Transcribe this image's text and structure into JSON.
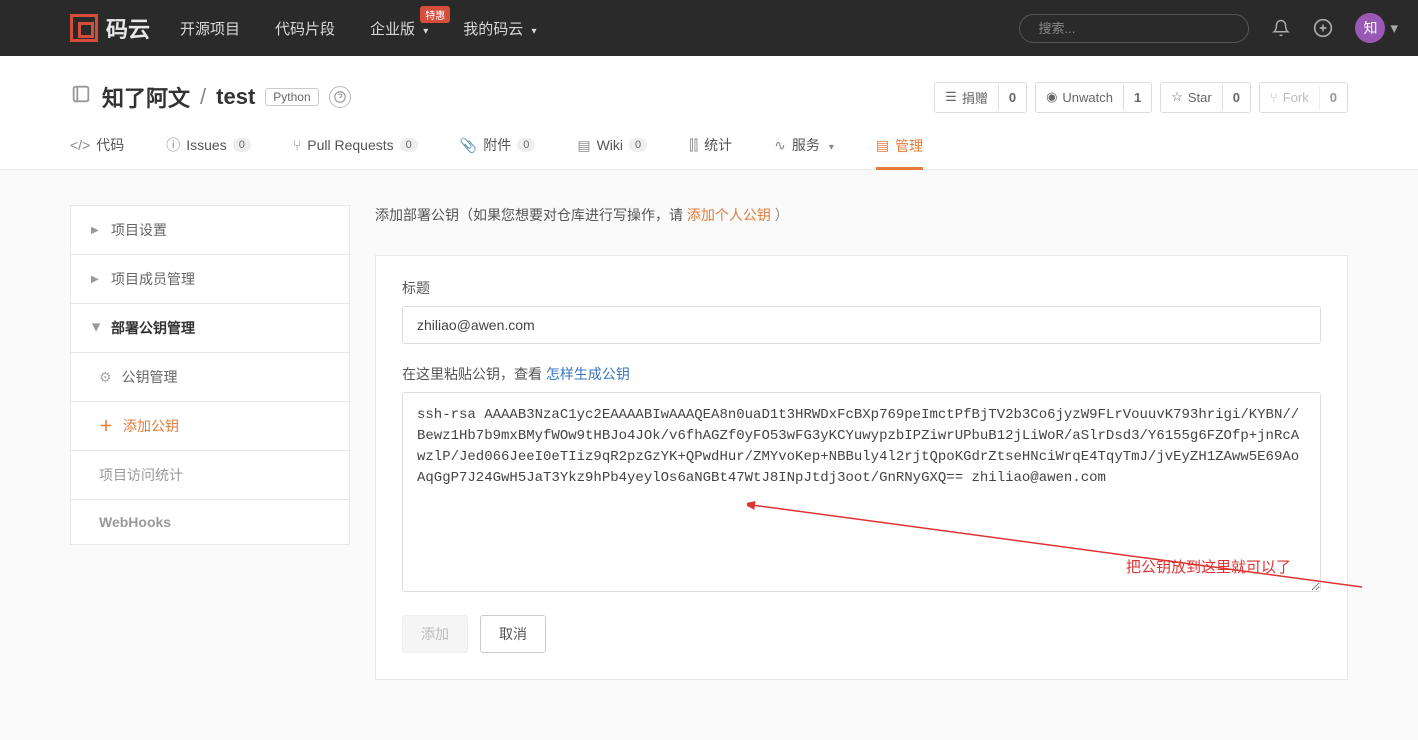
{
  "topnav": {
    "brand": "码云",
    "items": [
      "开源项目",
      "代码片段",
      "企业版",
      "我的码云"
    ],
    "promo_badge": "特惠",
    "search_placeholder": "搜索...",
    "avatar_text": "知"
  },
  "repo": {
    "owner": "知了阿文",
    "slash": "/",
    "name": "test",
    "lang": "Python",
    "actions": {
      "donate": {
        "label": "捐赠",
        "count": "0"
      },
      "unwatch": {
        "label": "Unwatch",
        "count": "1"
      },
      "star": {
        "label": "Star",
        "count": "0"
      },
      "fork": {
        "label": "Fork",
        "count": "0"
      }
    }
  },
  "tabs": {
    "code": "代码",
    "issues": {
      "label": "Issues",
      "count": "0"
    },
    "pr": {
      "label": "Pull Requests",
      "count": "0"
    },
    "attach": {
      "label": "附件",
      "count": "0"
    },
    "wiki": {
      "label": "Wiki",
      "count": "0"
    },
    "stats": "统计",
    "services": "服务",
    "manage": "管理"
  },
  "sidebar": {
    "project_settings": "项目设置",
    "members": "项目成员管理",
    "deploy_keys": "部署公钥管理",
    "key_manage": "公钥管理",
    "add_key": "添加公钥",
    "access_stats": "项目访问统计",
    "webhooks": "WebHooks"
  },
  "content": {
    "intro_prefix": "添加部署公钥（如果您想要对仓库进行写操作，请 ",
    "intro_link": "添加个人公钥",
    "intro_suffix": " ）",
    "title_label": "标题",
    "title_value": "zhiliao@awen.com",
    "key_label_prefix": "在这里粘贴公钥，查看 ",
    "key_label_link": "怎样生成公钥",
    "key_value": "ssh-rsa AAAAB3NzaC1yc2EAAAABIwAAAQEA8n0uaD1t3HRWDxFcBXp769peImctPfBjTV2b3Co6jyzW9FLrVouuvK793hrigi/KYBN//Bewz1Hb7b9mxBMyfWOw9tHBJo4JOk/v6fhAGZf0yFO53wFG3yKCYuwypzbIPZiwrUPbuB12jLiWoR/aSlrDsd3/Y6155g6FZOfp+jnRcAwzlP/Jed066JeeI0eTIiz9qR2pzGzYK+QPwdHur/ZMYvoKep+NBBuly4l2rjtQpoKGdrZtseHNciWrqE4TqyTmJ/jvEyZH1ZAww5E69AoAqGgP7J24GwH5JaT3Ykz9hPb4yeylOs6aNGBt47WtJ8INpJtdj3oot/GnRNyGXQ== zhiliao@awen.com",
    "annotation": "把公钥放到这里就可以了",
    "btn_add": "添加",
    "btn_cancel": "取消"
  }
}
